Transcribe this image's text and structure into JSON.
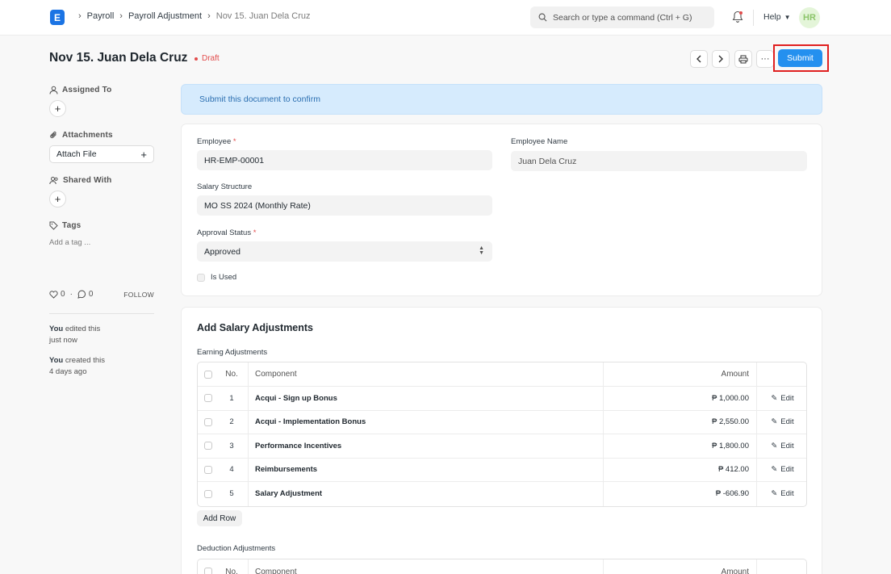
{
  "navbar": {
    "logo_letter": "E",
    "breadcrumbs": [
      "Payroll",
      "Payroll Adjustment",
      "Nov 15. Juan Dela Cruz"
    ],
    "search_placeholder": "Search or type a command (Ctrl + G)",
    "help_label": "Help",
    "avatar_initials": "HR"
  },
  "header": {
    "title": "Nov 15. Juan Dela Cruz",
    "status": "Draft",
    "more_label": "···",
    "submit_label": "Submit"
  },
  "sidebar": {
    "assigned_to": "Assigned To",
    "attachments": "Attachments",
    "attach_file": "Attach File",
    "shared_with": "Shared With",
    "tags": "Tags",
    "add_tag": "Add a tag ...",
    "likes": "0",
    "comments": "0",
    "follow": "FOLLOW",
    "activity": [
      {
        "who": "You",
        "action": "edited this",
        "when": "just now"
      },
      {
        "who": "You",
        "action": "created this",
        "when": "4 days ago"
      }
    ]
  },
  "alert": "Submit this document to confirm",
  "form": {
    "employee_label": "Employee",
    "employee_value": "HR-EMP-00001",
    "employee_name_label": "Employee Name",
    "employee_name_value": "Juan Dela Cruz",
    "salary_structure_label": "Salary Structure",
    "salary_structure_value": "MO SS 2024 (Monthly Rate)",
    "approval_status_label": "Approval Status",
    "approval_status_value": "Approved",
    "is_used_label": "Is Used"
  },
  "adjustments": {
    "section_title": "Add Salary Adjustments",
    "earning_label": "Earning Adjustments",
    "columns": {
      "no": "No.",
      "component": "Component",
      "amount": "Amount"
    },
    "edit_label": "Edit",
    "rows": [
      {
        "no": "1",
        "component": "Acqui - Sign up Bonus",
        "amount": "₱ 1,000.00"
      },
      {
        "no": "2",
        "component": "Acqui - Implementation Bonus",
        "amount": "₱ 2,550.00"
      },
      {
        "no": "3",
        "component": "Performance Incentives",
        "amount": "₱ 1,800.00"
      },
      {
        "no": "4",
        "component": "Reimbursements",
        "amount": "₱ 412.00"
      },
      {
        "no": "5",
        "component": "Salary Adjustment",
        "amount": "₱ -606.90"
      }
    ],
    "add_row_label": "Add Row",
    "deduction_label": "Deduction Adjustments"
  }
}
